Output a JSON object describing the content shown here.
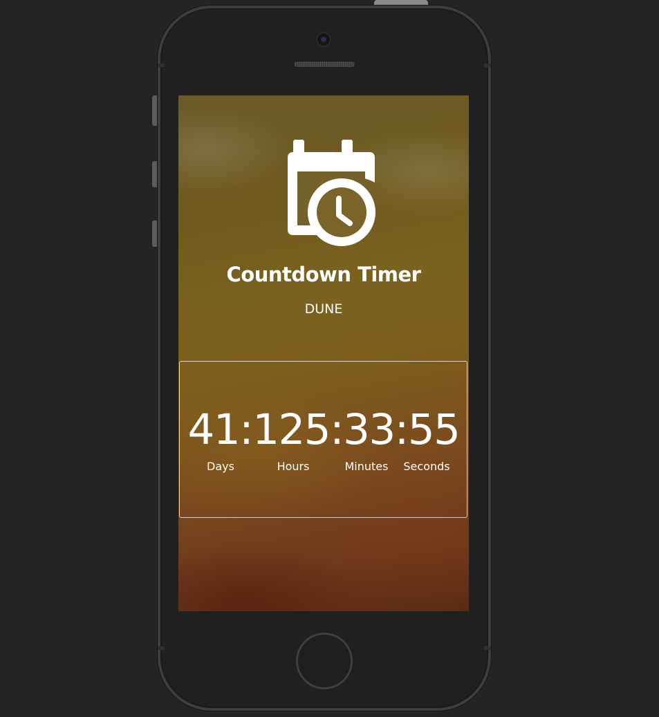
{
  "app": {
    "title": "Countdown Timer",
    "event_name": "DUNE"
  },
  "countdown": {
    "display": "41:125:33:55",
    "days": "41",
    "hours": "125",
    "minutes": "33",
    "seconds": "55",
    "labels": {
      "days": "Days",
      "hours": "Hours",
      "minutes": "Minutes",
      "seconds": "Seconds"
    }
  },
  "icons": {
    "header": "calendar-clock-icon"
  },
  "colors": {
    "page_background": "#242424",
    "text": "#ffffff",
    "screen_gradient_top": "#6d5a2a",
    "screen_gradient_bottom": "#5c2a14"
  }
}
